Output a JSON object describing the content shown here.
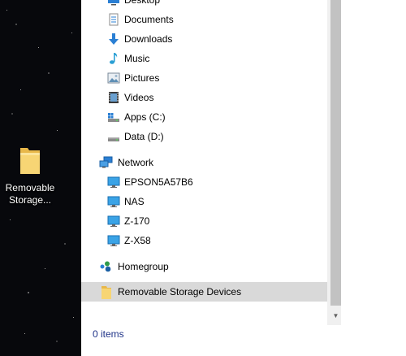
{
  "desktop": {
    "icon_label": "Removable Storage..."
  },
  "nav": {
    "items": [
      {
        "label": "Desktop",
        "icon": "desktop-icon"
      },
      {
        "label": "Documents",
        "icon": "documents-icon"
      },
      {
        "label": "Downloads",
        "icon": "downloads-icon"
      },
      {
        "label": "Music",
        "icon": "music-icon"
      },
      {
        "label": "Pictures",
        "icon": "pictures-icon"
      },
      {
        "label": "Videos",
        "icon": "videos-icon"
      },
      {
        "label": "Apps (C:)",
        "icon": "drive-c-icon"
      },
      {
        "label": "Data (D:)",
        "icon": "drive-d-icon"
      }
    ],
    "network": {
      "label": "Network",
      "icon": "network-icon",
      "computers": [
        {
          "label": "EPSON5A57B6",
          "icon": "computer-icon"
        },
        {
          "label": "NAS",
          "icon": "computer-icon"
        },
        {
          "label": "Z-170",
          "icon": "computer-icon"
        },
        {
          "label": "Z-X58",
          "icon": "computer-icon"
        }
      ]
    },
    "homegroup": {
      "label": "Homegroup",
      "icon": "homegroup-icon"
    },
    "removable": {
      "label": "Removable Storage Devices",
      "icon": "folder-icon",
      "selected": true
    }
  },
  "status": {
    "items_text": "0 items"
  },
  "colors": {
    "selection": "#d9d9d9",
    "status_text": "#1e3287",
    "folder": "#f7d574",
    "accent_blue": "#2a7fd4"
  }
}
